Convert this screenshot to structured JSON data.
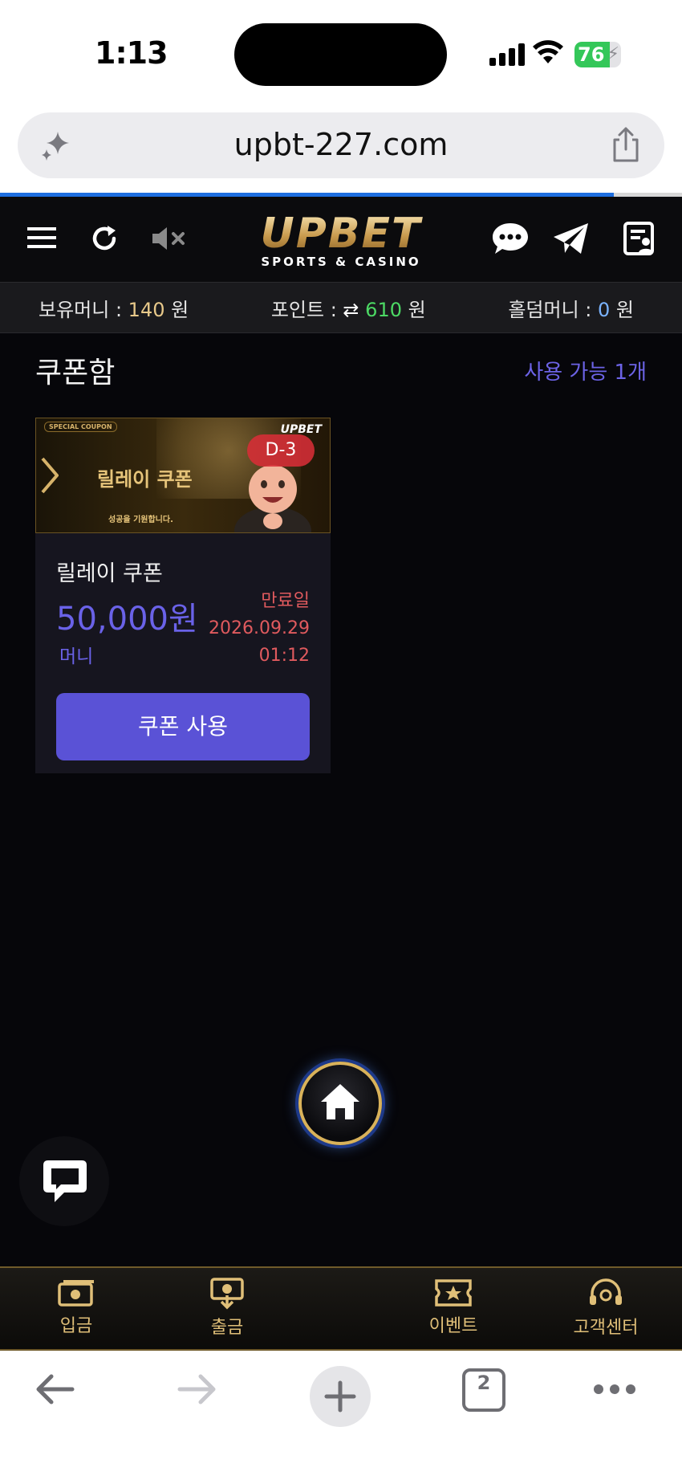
{
  "status_bar": {
    "time": "1:13",
    "battery": "76",
    "battery_level": 0.76
  },
  "browser": {
    "url": "upbt-227.com",
    "load_progress": 0.9,
    "tab_count": "2"
  },
  "site": {
    "logo_main": "UPBET",
    "logo_sub": "SPORTS & CASINO"
  },
  "balance": {
    "money_label": "보유머니 : ",
    "money_value": "140",
    "money_unit": " 원",
    "point_label": "포인트 : ",
    "point_value": "610",
    "point_unit": " 원",
    "holdem_label": "홀덤머니 : ",
    "holdem_value": "0",
    "holdem_unit": " 원"
  },
  "coupon_box": {
    "title": "쿠폰함",
    "available": "사용 가능 1개"
  },
  "coupon": {
    "banner_tag": "SPECIAL COUPON",
    "banner_title": "릴레이 쿠폰",
    "banner_sub": "성공을 기원합니다.",
    "banner_brand": "UPBET",
    "d_day": "D-3",
    "name": "릴레이 쿠폰",
    "amount": "50,000원",
    "type": "머니",
    "expiry_label": "만료일",
    "expiry_date": "2026.09.29",
    "expiry_time": "01:12",
    "use_button": "쿠폰 사용"
  },
  "bottom_nav": {
    "deposit": "입금",
    "withdraw": "출금",
    "event": "이벤트",
    "support": "고객센터"
  },
  "colors": {
    "accent": "#5a52d6",
    "gold": "#e0bf78",
    "expiry": "#e05a5e"
  }
}
